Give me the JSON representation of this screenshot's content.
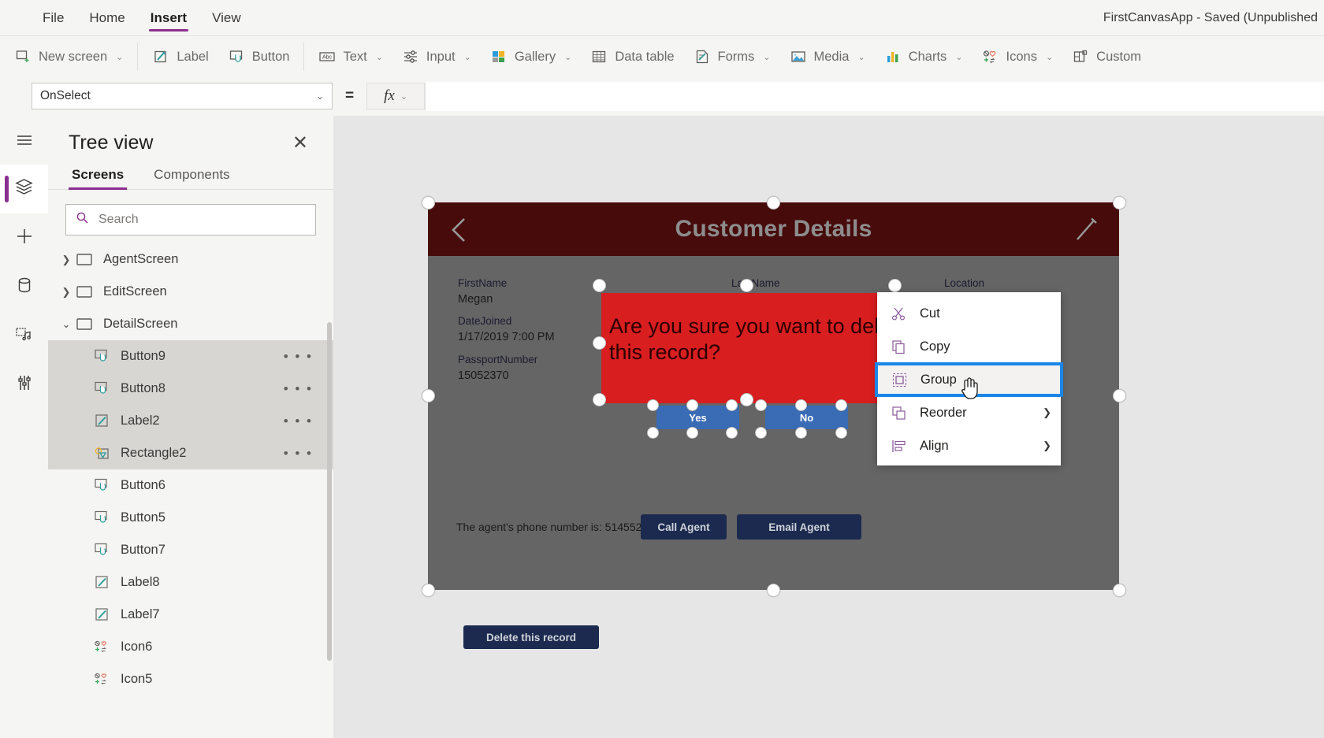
{
  "menu": {
    "items": [
      "File",
      "Home",
      "Insert",
      "View"
    ],
    "active": "Insert",
    "app_title": "FirstCanvasApp - Saved (Unpublished"
  },
  "ribbon": {
    "items": [
      {
        "label": "New screen",
        "icon": "new-screen-icon",
        "caret": true
      },
      {
        "label": "Label",
        "icon": "label-icon",
        "caret": false
      },
      {
        "label": "Button",
        "icon": "button-icon",
        "caret": false
      },
      {
        "label": "Text",
        "icon": "text-icon",
        "caret": true
      },
      {
        "label": "Input",
        "icon": "input-icon",
        "caret": true
      },
      {
        "label": "Gallery",
        "icon": "gallery-icon",
        "caret": true
      },
      {
        "label": "Data table",
        "icon": "data-table-icon",
        "caret": false
      },
      {
        "label": "Forms",
        "icon": "forms-icon",
        "caret": true
      },
      {
        "label": "Media",
        "icon": "media-icon",
        "caret": true
      },
      {
        "label": "Charts",
        "icon": "charts-icon",
        "caret": true
      },
      {
        "label": "Icons",
        "icon": "icons-icon",
        "caret": true
      },
      {
        "label": "Custom",
        "icon": "custom-icon",
        "caret": false
      }
    ]
  },
  "formula_bar": {
    "property": "OnSelect",
    "equals": "=",
    "fx": "fx",
    "formula_value": ""
  },
  "rail": {
    "items": [
      {
        "name": "hamburger-menu-icon"
      },
      {
        "name": "tree-view-icon",
        "selected": true
      },
      {
        "name": "insert-plus-icon"
      },
      {
        "name": "data-icon"
      },
      {
        "name": "media-library-icon"
      },
      {
        "name": "advanced-tools-icon"
      }
    ]
  },
  "tree_view": {
    "title": "Tree view",
    "close": "✕",
    "tabs": [
      {
        "label": "Screens",
        "active": true
      },
      {
        "label": "Components",
        "active": false
      }
    ],
    "search_placeholder": "Search",
    "search_value": "",
    "nodes": [
      {
        "label": "AgentScreen",
        "icon": "screen-icon",
        "level": 1,
        "chevron": "collapsed",
        "selected": false,
        "menu": false
      },
      {
        "label": "EditScreen",
        "icon": "screen-icon",
        "level": 1,
        "chevron": "collapsed",
        "selected": false,
        "menu": false
      },
      {
        "label": "DetailScreen",
        "icon": "screen-icon",
        "level": 1,
        "chevron": "expanded",
        "selected": false,
        "menu": false
      },
      {
        "label": "Button9",
        "icon": "button-icon",
        "level": 2,
        "chevron": "none",
        "selected": true,
        "menu": true
      },
      {
        "label": "Button8",
        "icon": "button-icon",
        "level": 2,
        "chevron": "none",
        "selected": true,
        "menu": true
      },
      {
        "label": "Label2",
        "icon": "label-icon",
        "level": 2,
        "chevron": "none",
        "selected": true,
        "menu": true
      },
      {
        "label": "Rectangle2",
        "icon": "rectangle-icon",
        "level": 2,
        "chevron": "none",
        "selected": true,
        "menu": true
      },
      {
        "label": "Button6",
        "icon": "button-icon",
        "level": 2,
        "chevron": "none",
        "selected": false,
        "menu": false
      },
      {
        "label": "Button5",
        "icon": "button-icon",
        "level": 2,
        "chevron": "none",
        "selected": false,
        "menu": false
      },
      {
        "label": "Button7",
        "icon": "button-icon",
        "level": 2,
        "chevron": "none",
        "selected": false,
        "menu": false
      },
      {
        "label": "Label8",
        "icon": "label-icon",
        "level": 2,
        "chevron": "none",
        "selected": false,
        "menu": false
      },
      {
        "label": "Label7",
        "icon": "label-icon",
        "level": 2,
        "chevron": "none",
        "selected": false,
        "menu": false
      },
      {
        "label": "Icon6",
        "icon": "icon-icon",
        "level": 2,
        "chevron": "none",
        "selected": false,
        "menu": false
      },
      {
        "label": "Icon5",
        "icon": "icon-icon",
        "level": 2,
        "chevron": "none",
        "selected": false,
        "menu": false
      }
    ],
    "row_menu_glyph": "• • •"
  },
  "canvas": {
    "screen_title": "Customer Details",
    "fields": [
      {
        "label": "FirstName",
        "value": "Megan"
      },
      {
        "label": "DateJoined",
        "value": "1/17/2019 7:00 PM"
      },
      {
        "label": "PassportNumber",
        "value": "15052370"
      },
      {
        "label": "LastName",
        "value": ""
      },
      {
        "label": "Location",
        "value": ""
      }
    ],
    "dialog_text": "Are you sure you want to delete this record?",
    "buttons": {
      "yes": "Yes",
      "no": "No",
      "call_agent": "Call Agent",
      "email_agent": "Email Agent",
      "delete_record": "Delete this record"
    },
    "agent_phone_text": "The agent's phone number is: 5145526695",
    "colors": {
      "header_maroon": "#470b0b",
      "screen_gray": "#656565",
      "dialog_red": "#d91e20",
      "button_blue": "#3a6cb5",
      "button_navy": "#1b2a4e"
    }
  },
  "context_menu": {
    "items": [
      {
        "label": "Cut",
        "icon": "scissors-icon",
        "submenu": false,
        "highlighted": false
      },
      {
        "label": "Copy",
        "icon": "copy-icon",
        "submenu": false,
        "highlighted": false
      },
      {
        "label": "Group",
        "icon": "group-icon",
        "submenu": false,
        "highlighted": true
      },
      {
        "label": "Reorder",
        "icon": "reorder-icon",
        "submenu": true,
        "highlighted": false
      },
      {
        "label": "Align",
        "icon": "align-icon",
        "submenu": true,
        "highlighted": false
      }
    ],
    "submenu_glyph": "❯",
    "highlight_color": "#1b86e8"
  }
}
